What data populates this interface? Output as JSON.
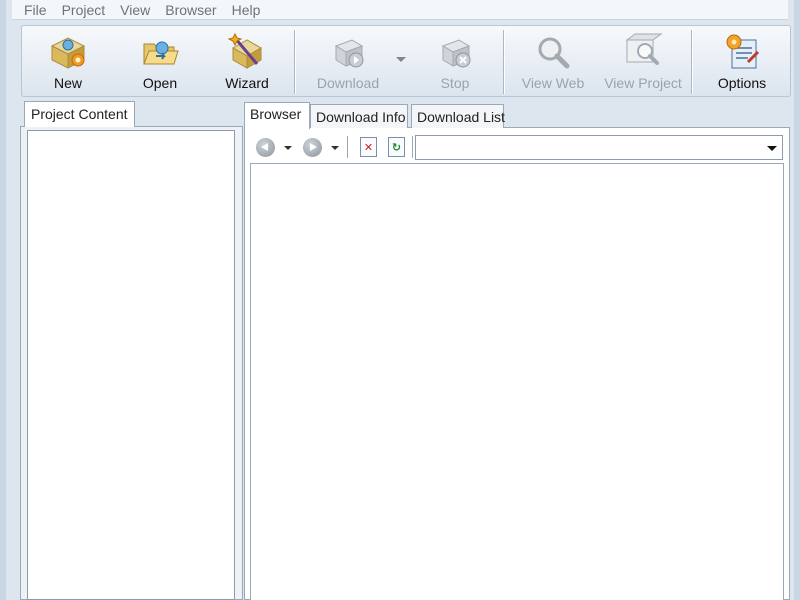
{
  "menu": [
    "File",
    "Project",
    "View",
    "Browser",
    "Help"
  ],
  "toolbar": {
    "new": "New",
    "open": "Open",
    "wizard": "Wizard",
    "download": "Download",
    "stop": "Stop",
    "view_web": "View Web",
    "view_project": "View Project",
    "options": "Options"
  },
  "left_panel": {
    "tab": "Project Content"
  },
  "right_panel": {
    "tabs": [
      "Browser",
      "Download Info",
      "Download List"
    ],
    "active_tab": "Browser",
    "address": {
      "value": ""
    }
  },
  "colors": {
    "menu_text": "#6a737c",
    "disabled_text": "#9aa3ad",
    "frame": "#c9d6e3"
  }
}
